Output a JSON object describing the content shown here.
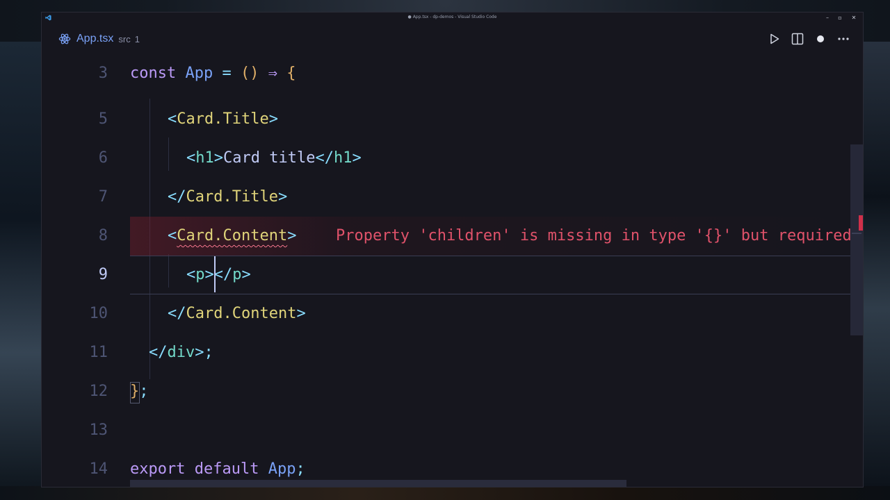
{
  "window": {
    "title": "● App.tsx - dp-demos - Visual Studio Code",
    "controls": {
      "minimize": "–",
      "maximize": "▫",
      "close": "✕"
    }
  },
  "tab": {
    "file_name": "App.tsx",
    "path": "src",
    "problem_count": "1",
    "icon": "react-icon"
  },
  "actions": [
    {
      "name": "run-icon"
    },
    {
      "name": "split-editor-icon"
    },
    {
      "name": "unsaved-dot-icon"
    },
    {
      "name": "more-actions-icon"
    }
  ],
  "editor": {
    "active_line": "9",
    "lines": [
      {
        "num": "3",
        "tokens": [
          "const",
          " ",
          "App",
          " = ",
          "()",
          " ⇒ ",
          "{"
        ]
      },
      {
        "num": "5",
        "tokens": [
          "<",
          "Card.Title",
          ">"
        ]
      },
      {
        "num": "6",
        "tokens": [
          "<",
          "h1",
          ">",
          "Card title",
          "</",
          "h1",
          ">"
        ]
      },
      {
        "num": "7",
        "tokens": [
          "</",
          "Card.Title",
          ">"
        ]
      },
      {
        "num": "8",
        "tokens": [
          "<",
          "Card.Content",
          ">"
        ]
      },
      {
        "num": "9",
        "tokens": [
          "<",
          "p",
          ">",
          "</",
          "p",
          ">"
        ]
      },
      {
        "num": "10",
        "tokens": [
          "</",
          "Card.Content",
          ">"
        ]
      },
      {
        "num": "11",
        "tokens": [
          "</",
          "div",
          ">;"
        ]
      },
      {
        "num": "12",
        "tokens": [
          "}",
          ";"
        ]
      },
      {
        "num": "13",
        "tokens": []
      },
      {
        "num": "14",
        "tokens": [
          "export",
          " ",
          "default",
          " ",
          "App",
          ";"
        ]
      }
    ],
    "error_message": "Property 'children' is missing in type '{}' but required"
  },
  "colors": {
    "background": "#16161e",
    "keyword": "#bb9af7",
    "function": "#7aa2f7",
    "jsx_tag": "#e0d47a",
    "html_tag": "#73daca",
    "error": "#e0526a"
  }
}
